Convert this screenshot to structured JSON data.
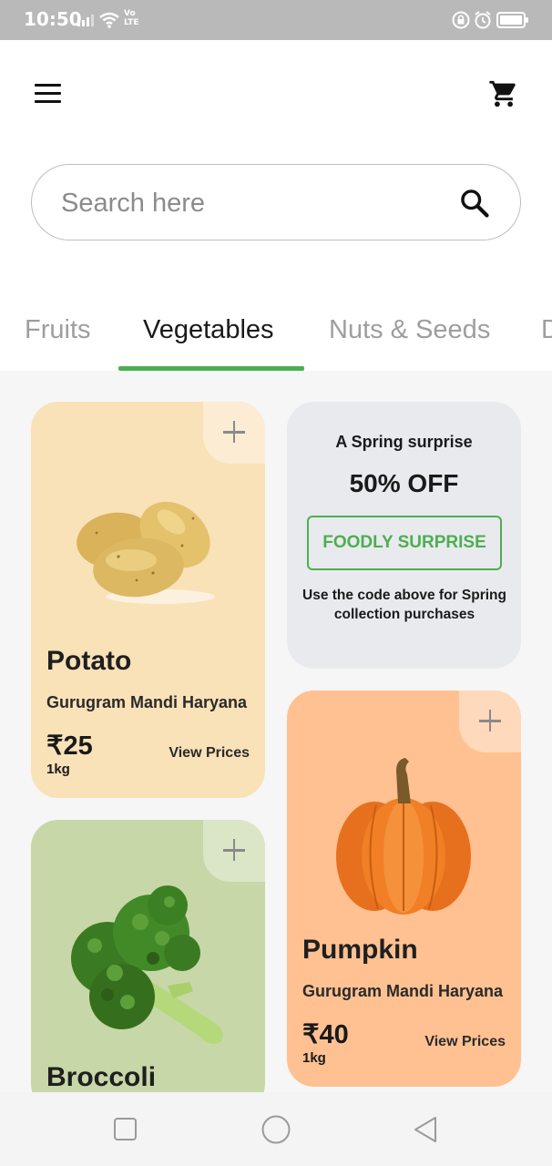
{
  "status_bar": {
    "time": "10:50",
    "network_label": "Vo\nLTE",
    "icons": [
      "signal-icon",
      "wifi-icon",
      "lock-icon",
      "alarm-icon",
      "battery-icon"
    ]
  },
  "app_bar": {
    "menu_icon": "hamburger-menu-icon",
    "cart_icon": "shopping-cart-icon"
  },
  "search": {
    "placeholder": "Search here",
    "value": "",
    "icon": "search-icon"
  },
  "tabs": [
    {
      "label": "Fruits",
      "active": false
    },
    {
      "label": "Vegetables",
      "active": true
    },
    {
      "label": "Nuts & Seeds",
      "active": false
    },
    {
      "label": "D",
      "active": false
    }
  ],
  "products": [
    {
      "name": "Potato",
      "origin": "Gurugram Mandi Haryana",
      "price": "₹25",
      "unit": "1kg",
      "view_label": "View Prices",
      "bg": "#f9e1b8"
    },
    {
      "name": "Pumpkin",
      "origin": "Gurugram Mandi Haryana",
      "price": "₹40",
      "unit": "1kg",
      "view_label": "View Prices",
      "bg": "#ffc191"
    },
    {
      "name": "Broccoli",
      "bg": "#c7d7a8"
    }
  ],
  "promo": {
    "title": "A Spring surprise",
    "discount": "50% OFF",
    "code": "FOODLY SURPRISE",
    "description": "Use the code above for Spring collection purchases"
  },
  "colors": {
    "accent": "#4caf50",
    "potato_card": "#f9e1b8",
    "pumpkin_card": "#ffc191",
    "broccoli_card": "#c7d7a8",
    "promo_card": "#e9eaee"
  },
  "nav_bar": [
    "recents-square-icon",
    "home-circle-icon",
    "back-triangle-icon"
  ]
}
